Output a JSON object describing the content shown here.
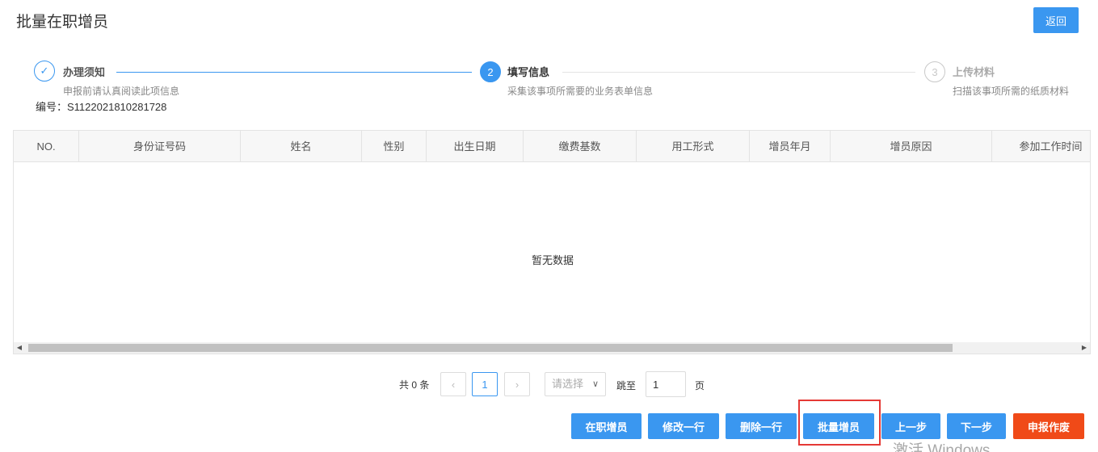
{
  "page": {
    "title": "批量在职增员",
    "back_label": "返回"
  },
  "steps": [
    {
      "state": "done",
      "marker": "✓",
      "title": "办理须知",
      "desc": "申报前请认真阅读此项信息"
    },
    {
      "state": "active",
      "marker": "2",
      "title": "填写信息",
      "desc": "采集该事项所需要的业务表单信息"
    },
    {
      "state": "todo",
      "marker": "3",
      "title": "上传材料",
      "desc": "扫描该事项所需的纸质材料"
    }
  ],
  "code_line": "编号：S1122021810281728",
  "table": {
    "columns": [
      "NO.",
      "身份证号码",
      "姓名",
      "性别",
      "出生日期",
      "缴费基数",
      "用工形式",
      "增员年月",
      "增员原因",
      "参加工作时间"
    ],
    "empty_text": "暂无数据"
  },
  "pagination": {
    "total_text": "共 0 条",
    "current_page": "1",
    "page_size_placeholder": "请选择",
    "jump_label": "跳至",
    "jump_value": "1",
    "page_label": "页"
  },
  "actions": {
    "in_service": "在职增员",
    "edit_row": "修改一行",
    "delete_row": "删除一行",
    "batch_add": "批量增员",
    "prev": "上一步",
    "next": "下一步",
    "void": "申报作废"
  },
  "watermark": "激活 Windows",
  "colors": {
    "primary": "#3a97f0",
    "danger": "#f04a18",
    "highlight": "#e53935"
  }
}
